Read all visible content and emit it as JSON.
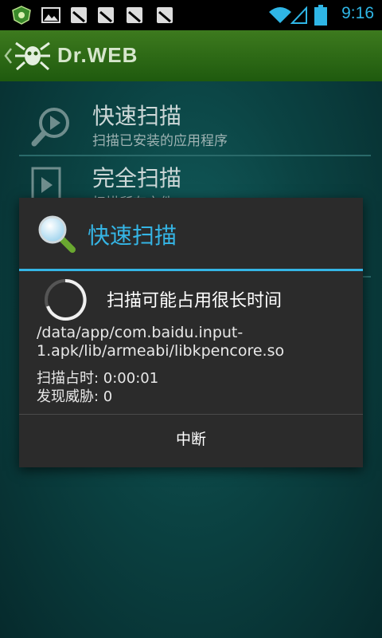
{
  "status_bar": {
    "time": "9:16",
    "icons": [
      "dr-web-app-icon",
      "image-notification-icon",
      "sd-card-icon",
      "sd-card-icon",
      "sd-card-icon",
      "sd-card-icon",
      "wifi-icon",
      "signal-icon",
      "battery-icon"
    ]
  },
  "action_bar": {
    "title": "Dr.WEB",
    "accent": "#35b5e5"
  },
  "menu": {
    "items": [
      {
        "title": "快速扫描",
        "subtitle": "扫描已安装的应用程序",
        "icon": "search-play-icon"
      },
      {
        "title": "完全扫描",
        "subtitle": "扫描所有文件",
        "icon": "file-play-icon"
      },
      {
        "title": "",
        "subtitle": "",
        "icon": ""
      },
      {
        "title": "",
        "subtitle": "",
        "icon": ""
      }
    ]
  },
  "dialog": {
    "title": "快速扫描",
    "message": "扫描可能占用很长时间",
    "path": "/data/app/com.baidu.input-1.apk/lib/armeabi/libkpencore.so",
    "elapsed": "扫描占时: 0:00:01",
    "threats": "发现威胁: 0",
    "cancel_label": "中断"
  }
}
